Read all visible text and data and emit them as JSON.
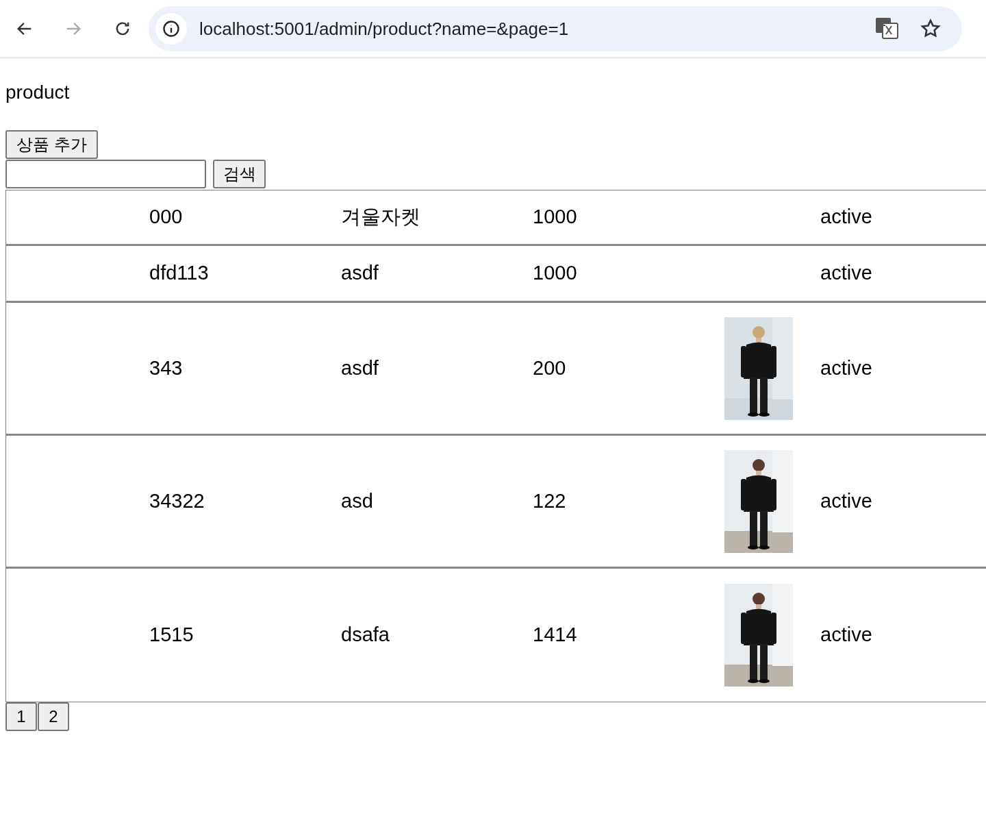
{
  "browser": {
    "url": "localhost:5001/admin/product?name=&page=1",
    "forward_disabled": true
  },
  "page": {
    "title": "product",
    "add_button": "상품 추가",
    "search_button": "검색"
  },
  "rows": [
    {
      "code": "000",
      "name": "겨울자켓",
      "price": "1000",
      "status": "active"
    },
    {
      "code": "dfd113",
      "name": "asdf",
      "price": "1000",
      "status": "active"
    },
    {
      "code": "343",
      "name": "asdf",
      "price": "200",
      "status": "active"
    },
    {
      "code": "34322",
      "name": "asd",
      "price": "122",
      "status": "active"
    },
    {
      "code": "1515",
      "name": "dsafa",
      "price": "1414",
      "status": "active"
    }
  ],
  "pagination": [
    "1",
    "2"
  ]
}
